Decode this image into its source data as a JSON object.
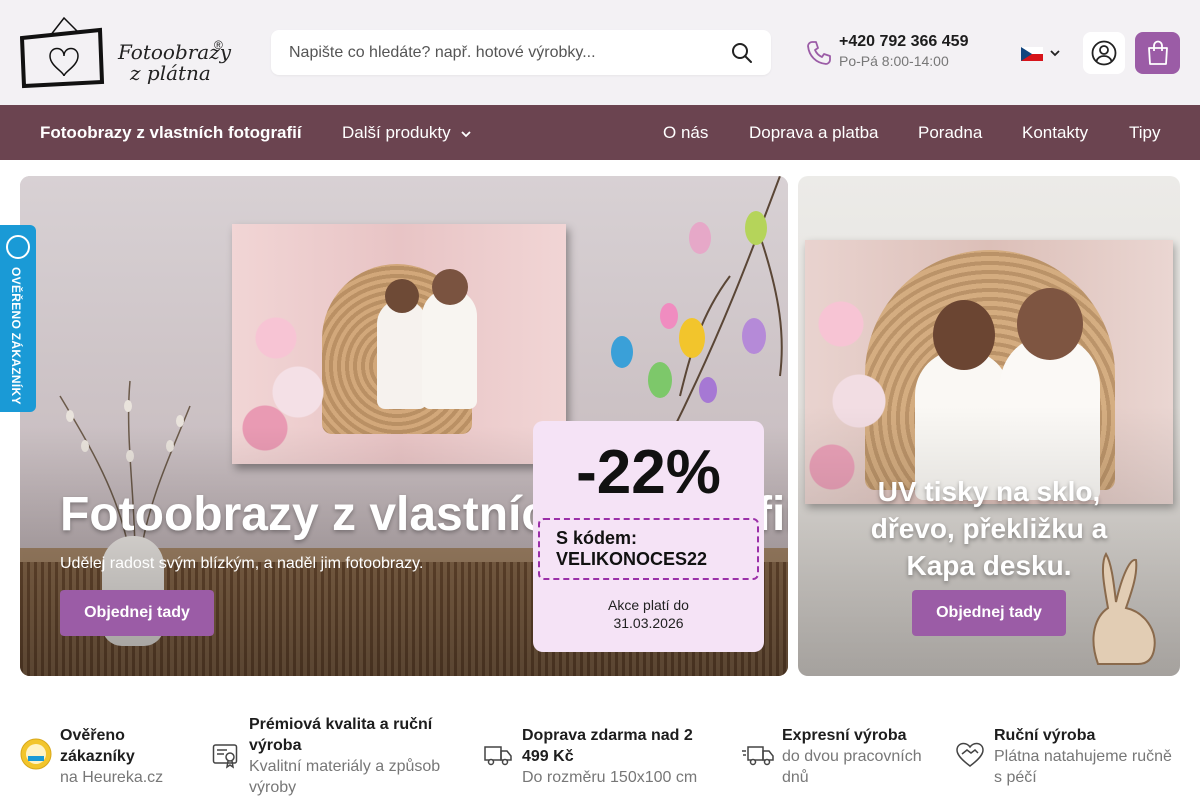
{
  "header": {
    "logo": {
      "line1": "Fotoobrazy",
      "line2": "z plátna",
      "reg": "®"
    },
    "search": {
      "placeholder": "Napište co hledáte? např. hotové výrobky..."
    },
    "phone": {
      "number": "+420 792 366 459",
      "hours": "Po-Pá 8:00-14:00"
    },
    "language": "cs"
  },
  "nav": {
    "items": [
      {
        "label": "Fotoobrazy z vlastních fotografií"
      },
      {
        "label": "Další produkty"
      },
      {
        "label": "O nás"
      },
      {
        "label": "Doprava a platba"
      },
      {
        "label": "Poradna"
      },
      {
        "label": "Kontakty"
      },
      {
        "label": "Tipy"
      }
    ]
  },
  "hero_left": {
    "title": "Fotoobrazy z vlastních fotografií",
    "subtitle": "Udělej radost svým blízkým, a naděl jim fotoobrazy.",
    "button": "Objednej tady"
  },
  "promo": {
    "discount": "-22%",
    "code_label": "S kódem:",
    "code": "VELIKONOCES22",
    "valid_line1": "Akce platí do",
    "valid_line2": "31.03.2026"
  },
  "hero_right": {
    "title_line1": "UV tisky na sklo,",
    "title_line2": "dřevo, překližku a",
    "title_line3": "Kapa desku.",
    "button": "Objednej tady"
  },
  "side_badge": {
    "text": "OVĚŘENO ZÁKAZNÍKY"
  },
  "features": [
    {
      "title_line1": "Ověřeno",
      "title_line2": "zákazníky",
      "sub_line1": "na Heureka.cz",
      "sub_line2": ""
    },
    {
      "title_line1": "Prémiová kvalita a ruční",
      "title_line2": "výroba",
      "sub_line1": "Kvalitní materiály a způsob",
      "sub_line2": "výroby"
    },
    {
      "title_line1": "Doprava zdarma nad 2",
      "title_line2": "499 Kč",
      "sub_line1": "Do rozměru 150x100 cm",
      "sub_line2": ""
    },
    {
      "title_line1": "Expresní výroba",
      "title_line2": "",
      "sub_line1": "do dvou pracovních",
      "sub_line2": "dnů"
    },
    {
      "title_line1": "Ruční výroba",
      "title_line2": "",
      "sub_line1": "Plátna natahujeme ručně",
      "sub_line2": "s péčí"
    }
  ],
  "colors": {
    "accent": "#9b5ca6",
    "nav": "#6b4450",
    "header_bg": "#f3f1f4",
    "promo_bg": "#f5e3f6",
    "badge": "#1a9ad6"
  }
}
